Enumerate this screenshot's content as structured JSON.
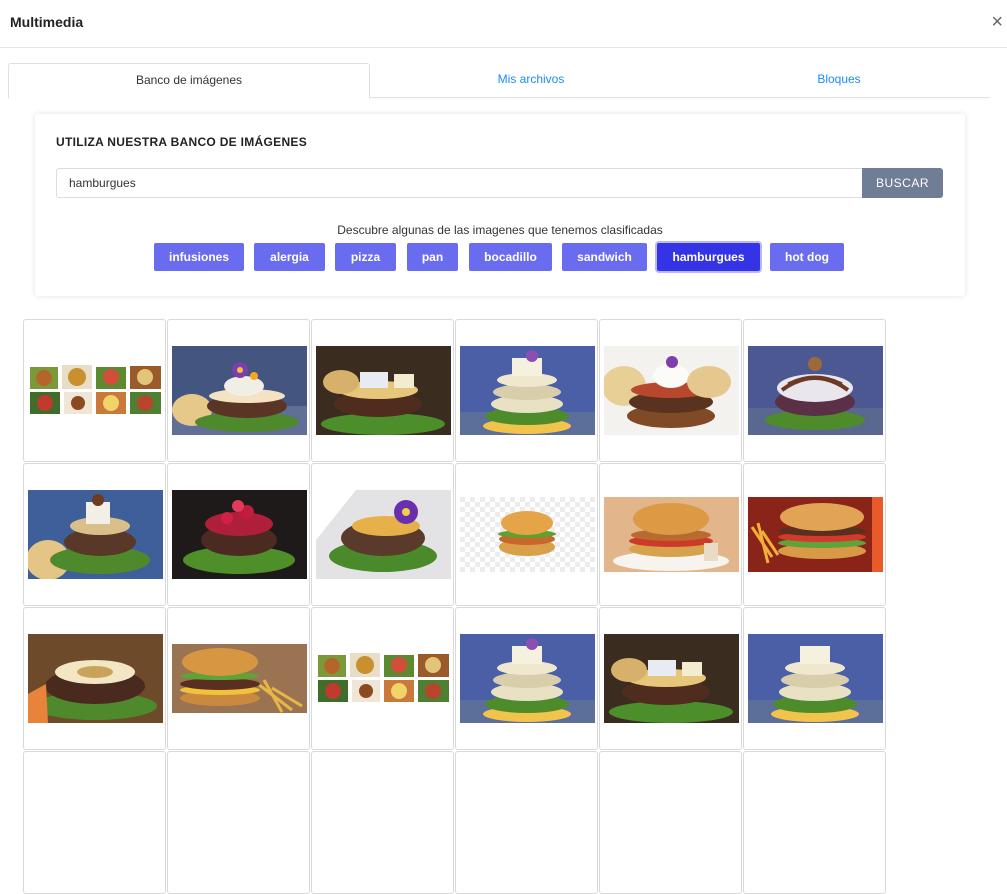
{
  "modal": {
    "title": "Multimedia",
    "close_glyph": "×"
  },
  "tabs": [
    {
      "label": "Banco de imágenes",
      "active": true
    },
    {
      "label": "Mis archivos",
      "active": false
    },
    {
      "label": "Bloques",
      "active": false
    }
  ],
  "search": {
    "heading": "UTILIZA NUESTRA BANCO DE IMÁGENES",
    "value": "hamburgues",
    "button_label": "BUSCAR",
    "discover_text": "Descubre algunas de las imagenes que tenemos clasificadas"
  },
  "tags": [
    {
      "label": "infusiones",
      "selected": false
    },
    {
      "label": "alergia",
      "selected": false
    },
    {
      "label": "pizza",
      "selected": false
    },
    {
      "label": "pan",
      "selected": false
    },
    {
      "label": "bocadillo",
      "selected": false
    },
    {
      "label": "sandwich",
      "selected": false
    },
    {
      "label": "hamburgues",
      "selected": true
    },
    {
      "label": "hot dog",
      "selected": false
    }
  ],
  "colors": {
    "tag": "#6a6cf0",
    "tag_selected": "#3434e6",
    "search_button": "#6f7d95",
    "tab_link": "#1a8cff"
  },
  "images": [
    {
      "kind": "collage"
    },
    {
      "kind": "burger-flower"
    },
    {
      "kind": "burger-cheese"
    },
    {
      "kind": "burger-tall-flower"
    },
    {
      "kind": "burger-cream"
    },
    {
      "kind": "burger-sauce"
    },
    {
      "kind": "burger-plate-blue"
    },
    {
      "kind": "burger-berries"
    },
    {
      "kind": "burger-violet"
    },
    {
      "kind": "burger-crispy-transparent"
    },
    {
      "kind": "burger-chicken-plate"
    },
    {
      "kind": "burger-fries-sign"
    },
    {
      "kind": "burger-ring-cheese"
    },
    {
      "kind": "burger-fries-wood"
    },
    {
      "kind": "collage"
    },
    {
      "kind": "burger-tall-flower"
    },
    {
      "kind": "burger-cheese"
    },
    {
      "kind": "burger-tall-flower"
    }
  ]
}
